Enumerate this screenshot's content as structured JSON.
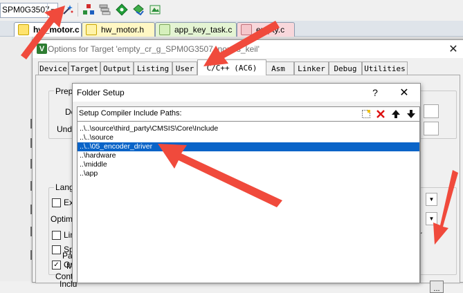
{
  "toolbar": {
    "target_name": "SPM0G3507_",
    "buttons": [
      {
        "icon": "magic-wand-icon"
      },
      {
        "icon": "component-manager-icon"
      },
      {
        "icon": "stack-icon"
      },
      {
        "icon": "green-diamond-icon"
      },
      {
        "icon": "pack-installer-icon"
      },
      {
        "icon": "layers-icon"
      }
    ]
  },
  "editor_tabs": [
    {
      "label": "hw_motor.c",
      "color": "#ffe36e",
      "active": true
    },
    {
      "label": "hw_motor.h",
      "color": "#fff3a8",
      "active": false
    },
    {
      "label": "app_key_task.c",
      "color": "#d6f0bc",
      "active": false
    },
    {
      "label": "empty.c",
      "color": "#f5c6cb",
      "active": false
    }
  ],
  "options_dialog": {
    "title": "Options for Target 'empty_cr_g_SPM0G3507_nortos_keil'",
    "tabs": [
      "Device",
      "Target",
      "Output",
      "Listing",
      "User",
      "C/C++ (AC6)",
      "Asm",
      "Linker",
      "Debug",
      "Utilities"
    ],
    "active_tab": "C/C++ (AC6)",
    "preprocessor": {
      "group_label": "Prepro",
      "define_label": "Def",
      "undefine_label": "Undef"
    },
    "language": {
      "group_label": "Langu",
      "execute_only": {
        "label": "Exe",
        "checked": false
      },
      "optimization_label": "Optimiz",
      "link_label": "Link",
      "split_label": "Spli",
      "one_elf": {
        "label": "One",
        "checked": true
      }
    },
    "include_label_1": "Inclu",
    "include_label_2": "Pat",
    "misc_label": "M",
    "controls_label": "Contr",
    "browse_label": "...",
    "right_fragment": "r"
  },
  "folder_setup": {
    "title": "Folder Setup",
    "help_label": "?",
    "close_label": "✕",
    "list_label": "Setup Compiler Include Paths:",
    "tools": [
      {
        "icon": "new-folder-icon"
      },
      {
        "icon": "delete-icon"
      },
      {
        "icon": "move-up-icon"
      },
      {
        "icon": "move-down-icon"
      }
    ],
    "paths": [
      "..\\..\\source\\third_party\\CMSIS\\Core\\Include",
      "..\\..\\source",
      "..\\..\\05_encoder_driver",
      "..\\hardware",
      "..\\middle",
      "..\\app"
    ],
    "selected_index": 2
  },
  "colors": {
    "accent": "#0a64c8",
    "arrow": "#f04a3c"
  }
}
